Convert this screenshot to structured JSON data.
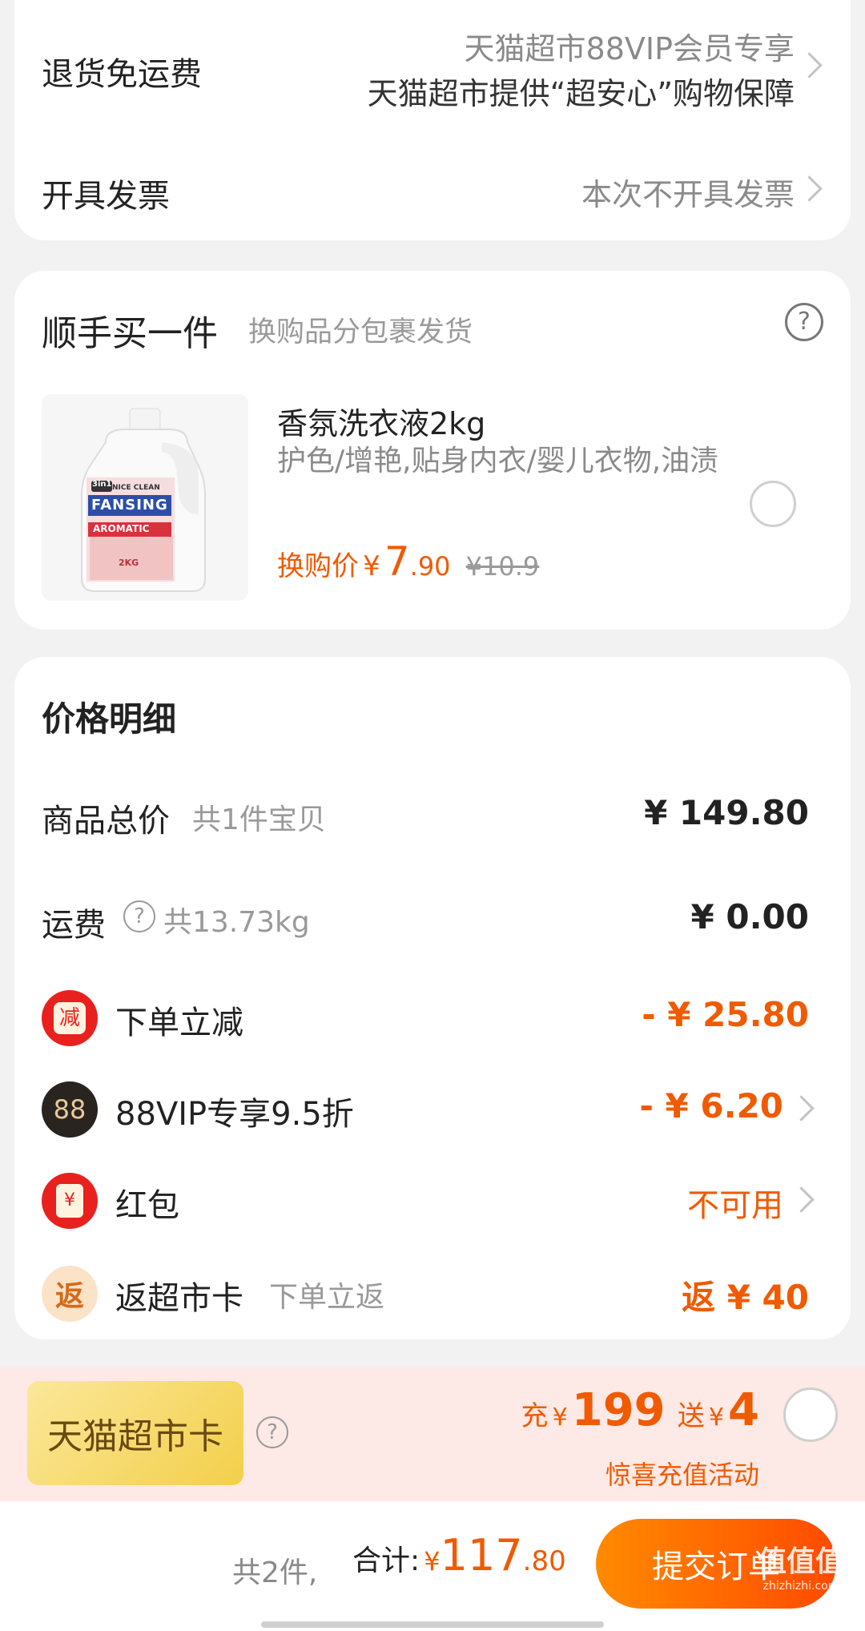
{
  "shipping": {
    "return_label": "退货免运费",
    "return_line1": "天猫超市88VIP会员专享",
    "return_line2": "天猫超市提供“超安心”购物保障",
    "invoice_label": "开具发票",
    "invoice_value": "本次不开具发票"
  },
  "addon": {
    "title": "顺手买一件",
    "subtitle": "换购品分包裹发货",
    "product": {
      "name": "香氛洗衣液2kg",
      "desc": "护色/增艳,贴身内衣/婴儿衣物,油渍",
      "price_label": "换购价",
      "currency": "¥",
      "price_int": "7",
      "price_dec": ".90",
      "orig_price": "¥10.9",
      "bottle_brand": "FANSING",
      "bottle_top": "NICE CLEAN",
      "bottle_type": "AROMATIC",
      "bottle_size": "2KG",
      "bottle_badge": "3in1"
    }
  },
  "price_detail": {
    "title": "价格明细",
    "rows": {
      "goods_label": "商品总价",
      "goods_sub": "共1件宝贝",
      "goods_value": "¥ 149.80",
      "freight_label": "运费",
      "freight_sub": "共13.73kg",
      "freight_value": "¥ 0.00",
      "discount_label": "下单立减",
      "discount_value": "- ¥ 25.80",
      "discount_icon": "减",
      "vip_label": "88VIP专享9.5折",
      "vip_value": "- ¥ 6.20",
      "vip_icon": "88",
      "redpacket_label": "红包",
      "redpacket_value": "不可用",
      "redpacket_icon": "¥",
      "cashback_label": "返超市卡",
      "cashback_sub": "下单立返",
      "cashback_value": "返 ¥ 40",
      "cashback_icon": "返"
    }
  },
  "card_promo": {
    "card_label": "天猫超市卡",
    "recharge_prefix": "充",
    "currency": "¥",
    "recharge_amount": "199",
    "gift_prefix": "送",
    "gift_amount": "4",
    "activity": "惊喜充值活动"
  },
  "footer": {
    "count": "共2件,",
    "total_label": "合计:",
    "currency": "¥",
    "total_int": "117",
    "total_dec": ".80",
    "submit": "提交订单",
    "watermark": "值值值",
    "watermark_url": "zhizhizhi.com"
  },
  "colors": {
    "accent": "#f05a00",
    "submit_gradient_start": "#ff8a00",
    "submit_gradient_end": "#ff4a00",
    "card_gold": "#f6d45a"
  }
}
